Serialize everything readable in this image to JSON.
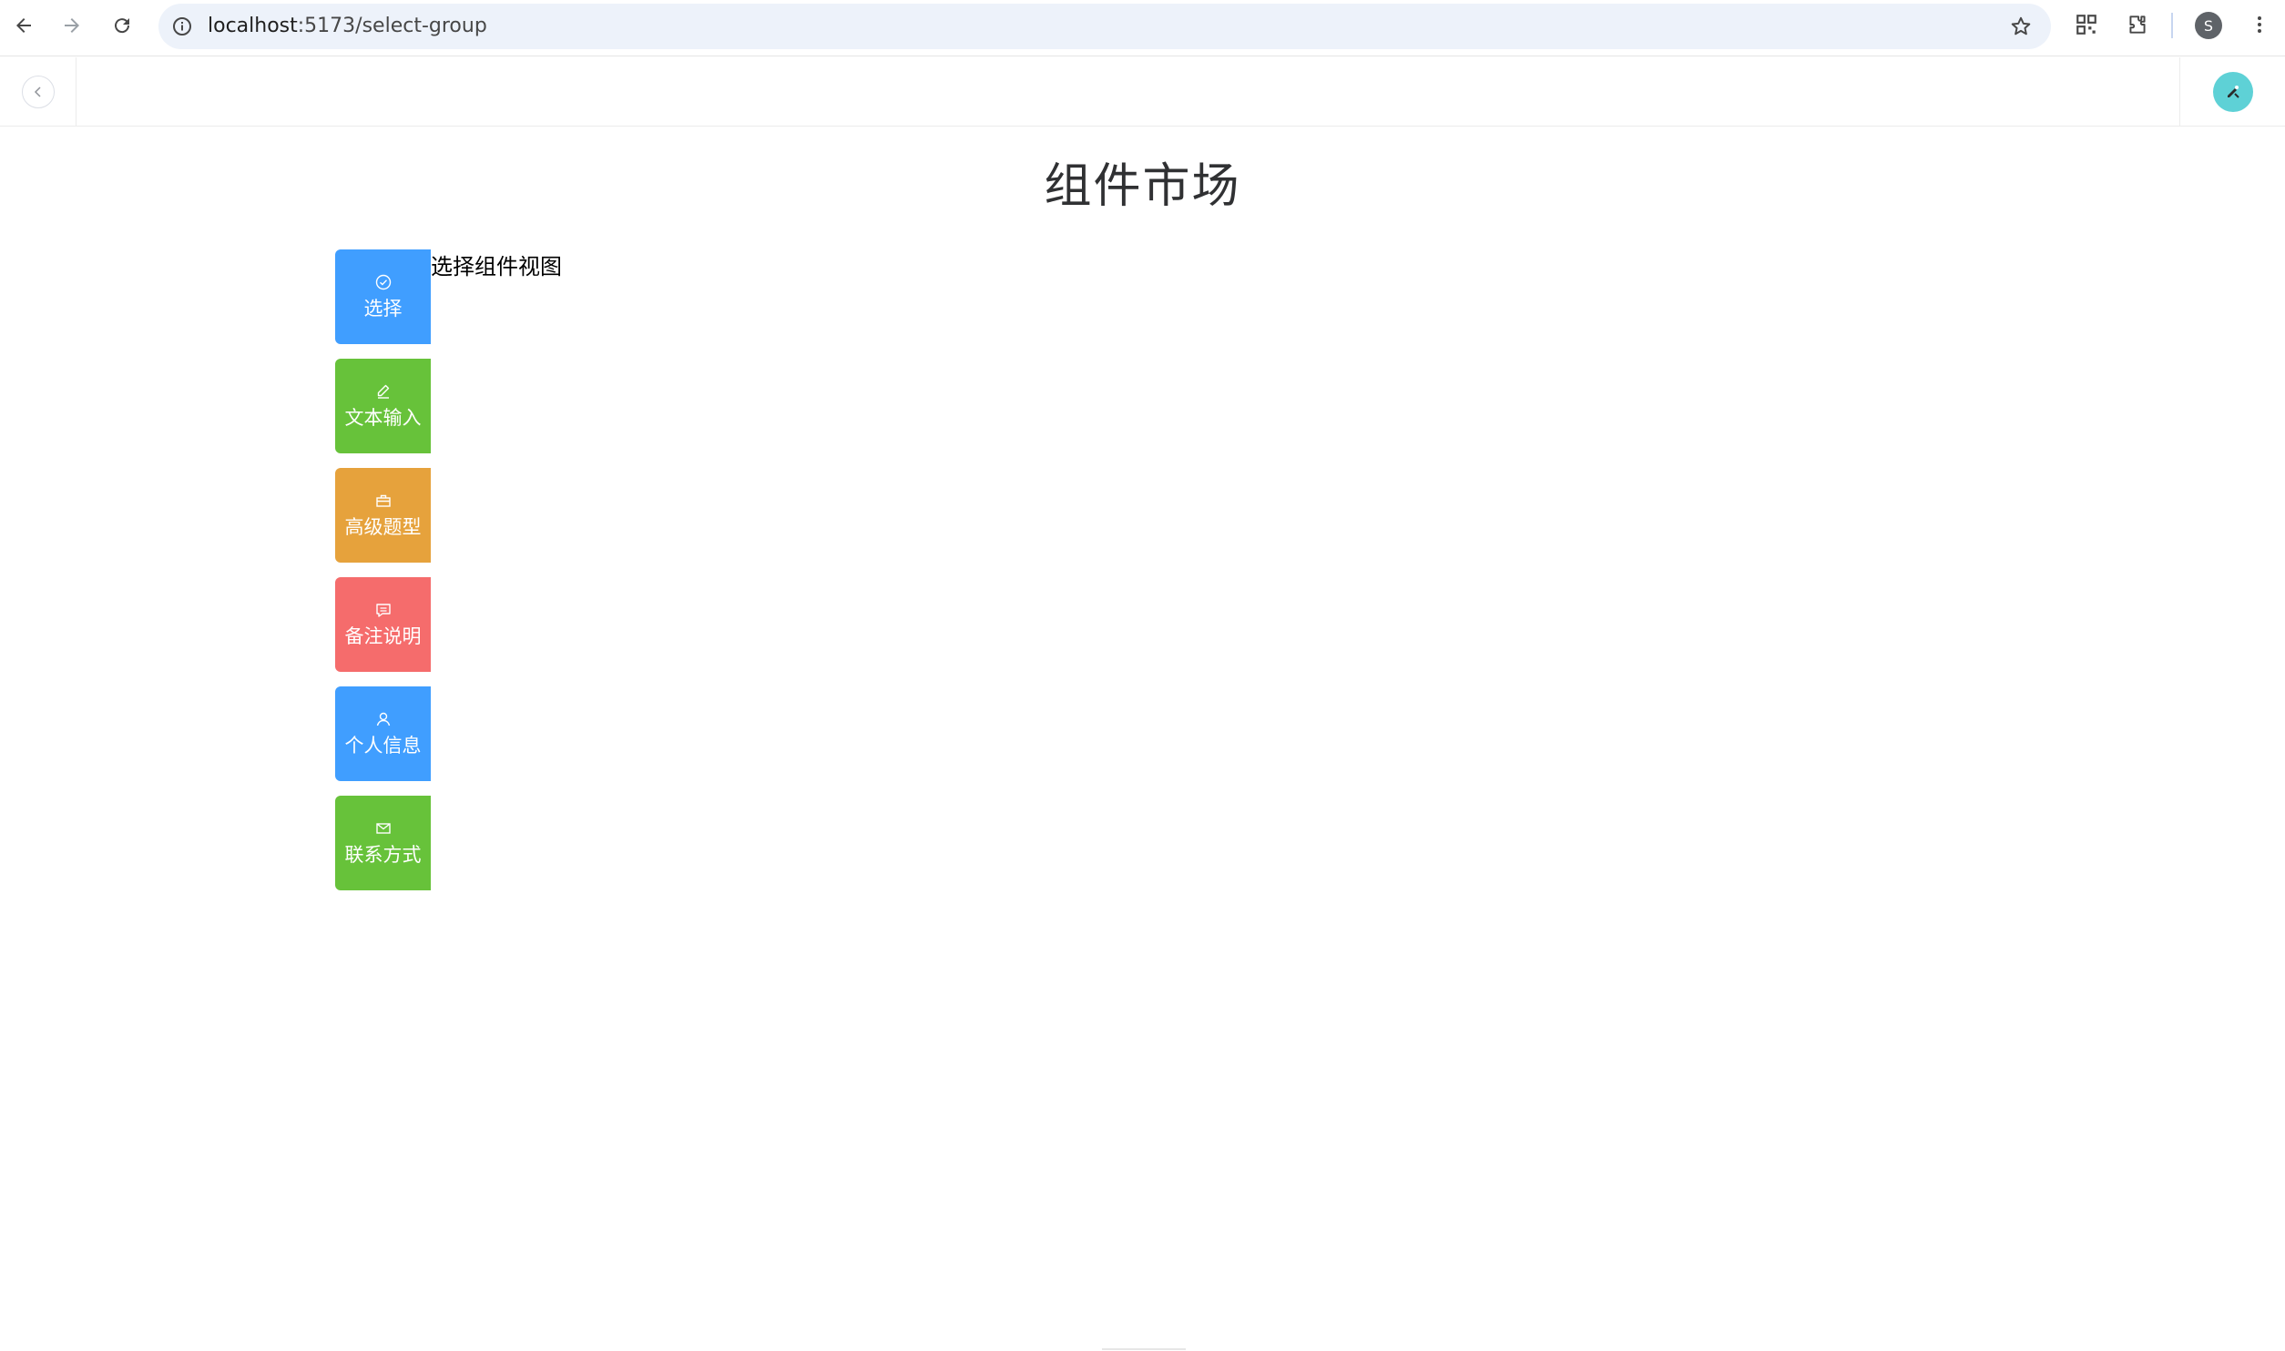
{
  "browser": {
    "url_host": "localhost",
    "url_path": ":5173/select-group",
    "profile_initial": "S"
  },
  "page": {
    "title": "组件市场",
    "view_label": "选择组件视图"
  },
  "groups": [
    {
      "label": "选择",
      "icon": "circle-check-icon",
      "color": "#409eff"
    },
    {
      "label": "文本输入",
      "icon": "edit-pen-icon",
      "color": "#67c23a"
    },
    {
      "label": "高级题型",
      "icon": "briefcase-icon",
      "color": "#e6a23c"
    },
    {
      "label": "备注说明",
      "icon": "chat-square-icon",
      "color": "#f56c6c"
    },
    {
      "label": "个人信息",
      "icon": "user-icon",
      "color": "#409eff"
    },
    {
      "label": "联系方式",
      "icon": "message-icon",
      "color": "#67c23a"
    }
  ],
  "colors": {
    "avatar_bg": "#5ed1d6",
    "omnibox_bg": "#edf2fa"
  }
}
